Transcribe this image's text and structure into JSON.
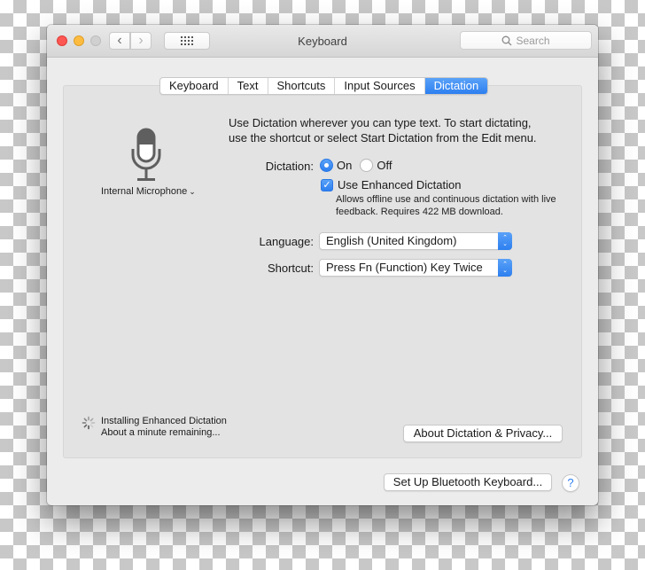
{
  "window": {
    "title": "Keyboard",
    "search_placeholder": "Search",
    "nav": {
      "back_glyph": "‹",
      "forward_glyph": "›"
    }
  },
  "tabs": [
    {
      "label": "Keyboard",
      "active": false
    },
    {
      "label": "Text",
      "active": false
    },
    {
      "label": "Shortcuts",
      "active": false
    },
    {
      "label": "Input Sources",
      "active": false
    },
    {
      "label": "Dictation",
      "active": true
    }
  ],
  "microphone": {
    "icon": "microphone-icon",
    "source_label": "Internal Microphone",
    "chevron": "⌄"
  },
  "dictation": {
    "intro": "Use Dictation wherever you can type text. To start dictating, use the shortcut or select Start Dictation from the Edit menu.",
    "label": "Dictation:",
    "options": [
      {
        "label": "On",
        "selected": true
      },
      {
        "label": "Off",
        "selected": false
      }
    ],
    "enhanced": {
      "label": "Use Enhanced Dictation",
      "checked": true,
      "check_glyph": "✓",
      "description": "Allows offline use and continuous dictation with live feedback. Requires 422 MB download."
    },
    "language": {
      "label": "Language:",
      "value": "English (United Kingdom)"
    },
    "shortcut": {
      "label": "Shortcut:",
      "value": "Press Fn (Function) Key Twice"
    }
  },
  "status": {
    "line1": "Installing Enhanced Dictation",
    "line2": "About a minute remaining..."
  },
  "buttons": {
    "about": "About Dictation & Privacy...",
    "bluetooth": "Set Up Bluetooth Keyboard...",
    "help": "?"
  },
  "colors": {
    "accent": "#2d7ff0",
    "close": "#fc5753",
    "minimize": "#fdbc40",
    "zoom_disabled": "#d0d0d0"
  }
}
